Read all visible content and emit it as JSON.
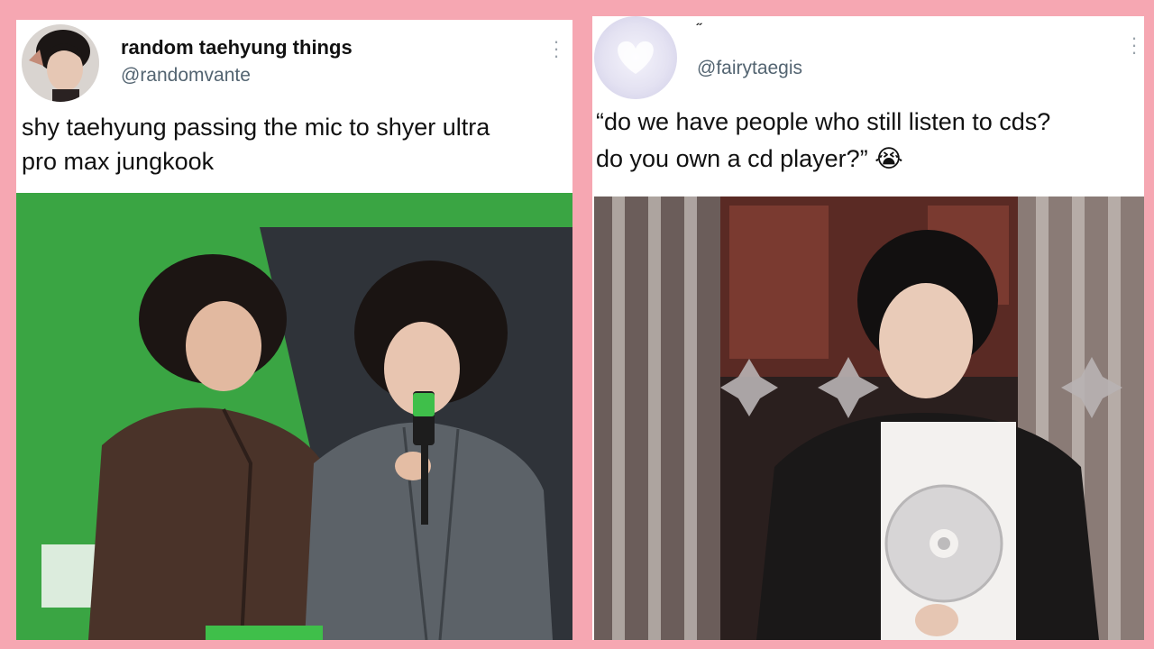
{
  "left_tweet": {
    "display_name": "random taehyung things",
    "handle": "@randomvante",
    "text_line1": "shy taehyung passing the mic to shyer ultra",
    "text_line2": "pro max jungkook",
    "more_icon": "more-vertical-icon"
  },
  "right_tweet": {
    "display_name": "˝",
    "handle": "@fairytaegis",
    "text_line1": "“do we have people who still listen to cds?",
    "text_line2": "do you own a cd player?” 😭",
    "more_icon": "more-vertical-icon"
  },
  "colors": {
    "background": "#f6a7b2",
    "card": "#ffffff",
    "handle": "#536471",
    "left_media_green": "#3aa543"
  }
}
